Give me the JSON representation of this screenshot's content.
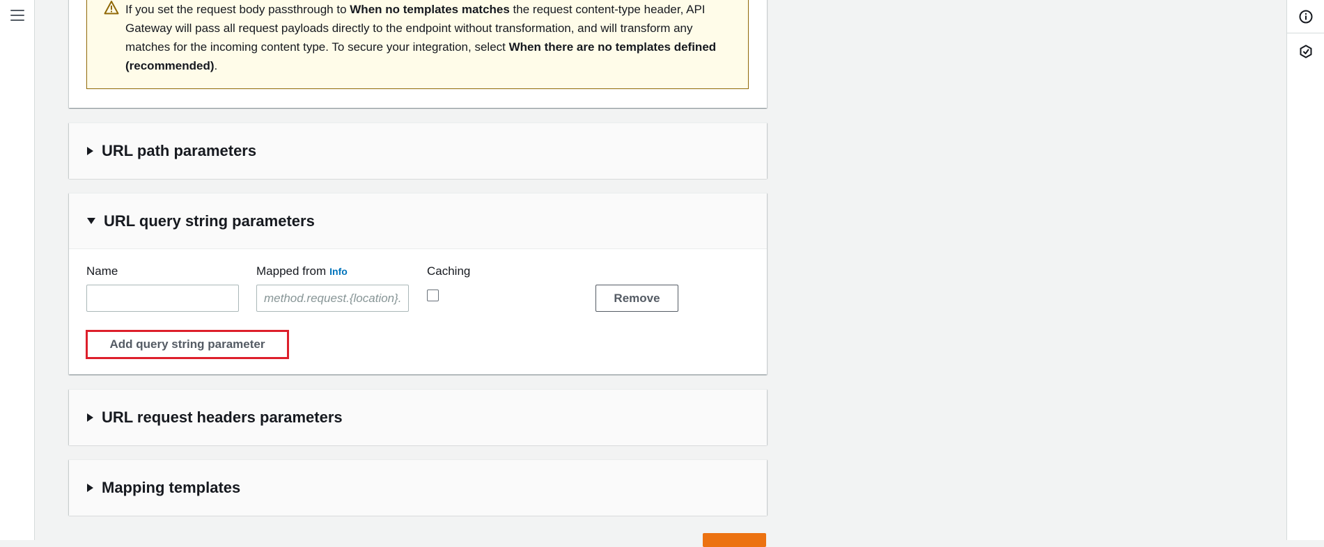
{
  "nav": {
    "menu_icon": "hamburger-menu-icon"
  },
  "tools": {
    "info_icon": "info-icon",
    "feedback_icon": "hexagon-icon"
  },
  "alert": {
    "icon": "warning-icon",
    "text_1": "If you set the request body passthrough to ",
    "bold_1": "When no templates matches",
    "text_2": " the request content-type header, API Gateway will pass all request payloads directly to the endpoint without transformation, and will transform any matches for the incoming content type. To secure your integration, select ",
    "bold_2": "When there are no templates defined (recommended)",
    "text_3": "."
  },
  "sections": {
    "path": {
      "title": "URL path parameters",
      "expanded": false
    },
    "query": {
      "title": "URL query string parameters",
      "expanded": true
    },
    "headers": {
      "title": "URL request headers parameters",
      "expanded": false
    },
    "mapping": {
      "title": "Mapping templates",
      "expanded": false
    }
  },
  "query_params": {
    "name_label": "Name",
    "mapped_from_label": "Mapped from",
    "info_link": "Info",
    "caching_label": "Caching",
    "name_value": "",
    "mapped_from_placeholder": "method.request.{location}.{name}",
    "caching_checked": false,
    "remove_label": "Remove",
    "add_label": "Add query string parameter"
  },
  "colors": {
    "alert_bg": "#fffce9",
    "alert_border": "#906806",
    "link": "#0073bb",
    "highlight": "#dd1f2b",
    "primary": "#ec7211"
  }
}
